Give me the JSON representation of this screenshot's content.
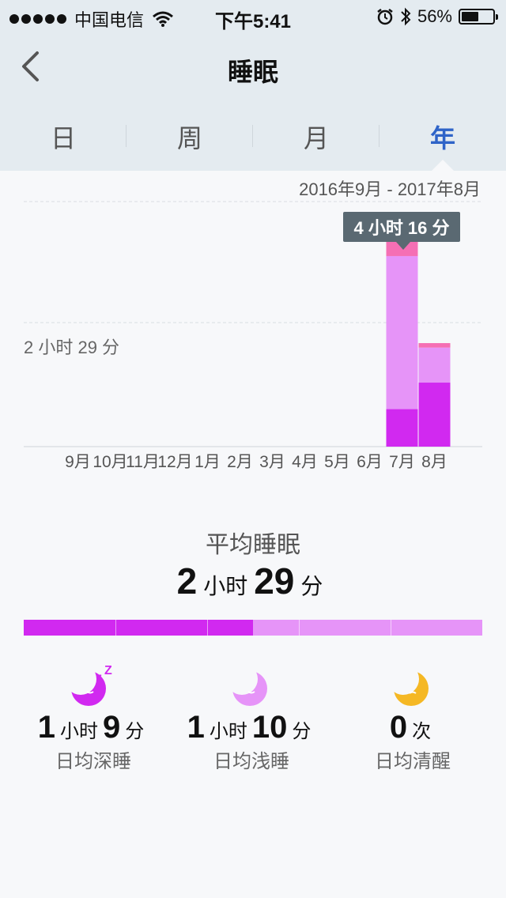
{
  "status_bar": {
    "carrier": "中国电信",
    "time": "下午5:41",
    "battery": "56%",
    "battery_level": 0.56
  },
  "nav": {
    "title": "睡眠",
    "back_icon": "chevron-left-icon"
  },
  "tabs": [
    {
      "label": "日",
      "active": false
    },
    {
      "label": "周",
      "active": false
    },
    {
      "label": "月",
      "active": false
    },
    {
      "label": "年",
      "active": true
    }
  ],
  "range_label": "2016年9月 - 2017年8月",
  "chart_data": {
    "type": "bar",
    "stacked": true,
    "categories": [
      "9月",
      "10月",
      "11月",
      "12月",
      "1月",
      "2月",
      "3月",
      "4月",
      "5月",
      "6月",
      "7月",
      "8月"
    ],
    "series": [
      {
        "name": "深睡",
        "color": "#d129f0",
        "values": [
          0,
          0,
          0,
          0,
          0,
          0,
          0,
          0,
          0,
          0,
          0.75,
          1.28
        ]
      },
      {
        "name": "浅睡",
        "color": "#e694f8",
        "values": [
          0,
          0,
          0,
          0,
          0,
          0,
          0,
          0,
          0,
          0,
          3.06,
          0.7
        ]
      },
      {
        "name": "清醒",
        "color": "#f56fb4",
        "values": [
          0,
          0,
          0,
          0,
          0,
          0,
          0,
          0,
          0,
          0,
          0.45,
          0.09
        ]
      }
    ],
    "ylim": [
      0,
      4.9
    ],
    "average_line": 2.48,
    "average_label": "2 小时 29 分",
    "selected_category": "7月",
    "tooltip": "4 小时 16 分"
  },
  "average": {
    "title": "平均睡眠",
    "hours": "2",
    "hours_unit": "小时",
    "minutes": "29",
    "minutes_unit": "分",
    "deep_ratio": 0.5
  },
  "stats": [
    {
      "icon": "deep-sleep-moon-icon",
      "color": "#d129f0",
      "parts": [
        "1",
        "小时",
        "9",
        "分"
      ],
      "label": "日均深睡"
    },
    {
      "icon": "light-sleep-moon-icon",
      "color": "#e694f8",
      "parts": [
        "1",
        "小时",
        "10",
        "分"
      ],
      "label": "日均浅睡"
    },
    {
      "icon": "awake-moon-icon",
      "color": "#f5b824",
      "parts": [
        "0",
        "次"
      ],
      "label": "日均清醒"
    }
  ]
}
